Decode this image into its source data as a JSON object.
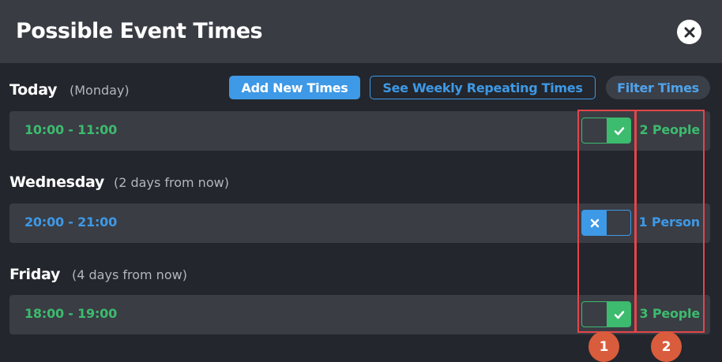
{
  "header": {
    "title": "Possible Event Times"
  },
  "toolbar": {
    "add_label": "Add New Times",
    "weekly_label": "See Weekly Repeating Times",
    "filter_label": "Filter Times"
  },
  "days": [
    {
      "name": "Today",
      "sub": "(Monday)",
      "time": "10:00 - 11:00",
      "toggle": "on",
      "count": "2 People"
    },
    {
      "name": "Wednesday",
      "sub": "(2 days from now)",
      "time": "20:00 - 21:00",
      "toggle": "off",
      "count": "1 Person"
    },
    {
      "name": "Friday",
      "sub": "(4 days from now)",
      "time": "18:00 - 19:00",
      "toggle": "on",
      "count": "3 People"
    }
  ],
  "annotations": {
    "first": "1",
    "second": "2"
  },
  "colors": {
    "green": "#3dbb6e",
    "blue": "#3e99e6",
    "annotation": "#e4464a"
  },
  "icons": {
    "close": "close-icon",
    "check": "check-icon",
    "cross": "x-icon"
  }
}
